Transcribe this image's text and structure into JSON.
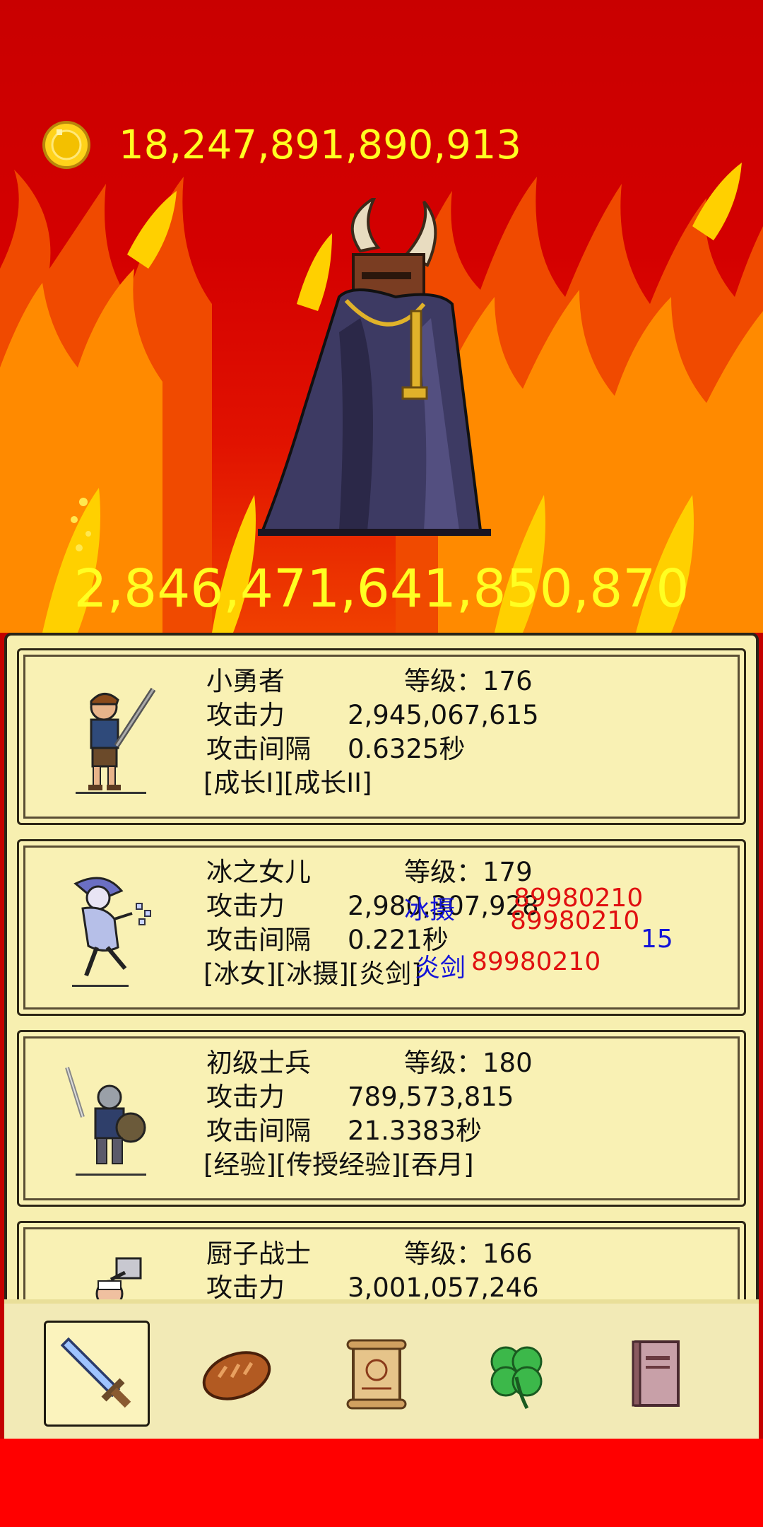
{
  "gold": {
    "icon": "gold-coin-icon",
    "amount": "18,247,891,890,913"
  },
  "boss": {
    "icon": "horned-demon-boss",
    "hp": "2,846,471,641,850,870"
  },
  "heroes": [
    {
      "name": "小勇者",
      "level_label": "等级：",
      "level": "176",
      "attack_label": "攻击力",
      "attack": "2,945,067,615",
      "interval_label": "攻击间隔",
      "interval": "0.6325秒",
      "skills": "[成长I][成长II]",
      "icon": "young-hero-sprite"
    },
    {
      "name": "冰之女儿",
      "level_label": "等级：",
      "level": "179",
      "attack_label": "攻击力",
      "attack": "2,980,307,928",
      "interval_label": "攻击间隔",
      "interval": "0.221秒",
      "skills": "[冰女][冰摄][炎剑]",
      "icon": "ice-daughter-sprite"
    },
    {
      "name": "初级士兵",
      "level_label": "等级：",
      "level": "180",
      "attack_label": "攻击力",
      "attack": "789,573,815",
      "interval_label": "攻击间隔",
      "interval": "21.3383秒",
      "skills": "[经验][传授经验][吞月]",
      "icon": "soldier-sprite"
    },
    {
      "name": "厨子战士",
      "level_label": "等级：",
      "level": "166",
      "attack_label": "攻击力",
      "attack": "3,001,057,246",
      "interval_label": "",
      "interval": "",
      "skills": "",
      "icon": "chef-warrior-sprite"
    }
  ],
  "damage_floats": [
    {
      "text": "冰摄",
      "color": "blue"
    },
    {
      "text": "89980210",
      "color": "red"
    },
    {
      "text": "89980210",
      "color": "red"
    },
    {
      "text": "15",
      "color": "blue"
    },
    {
      "text": "炎剑",
      "color": "blue"
    },
    {
      "text": "89980210",
      "color": "red"
    }
  ],
  "tabs": [
    {
      "icon": "sword-icon",
      "active": true
    },
    {
      "icon": "bread-icon",
      "active": false
    },
    {
      "icon": "scroll-icon",
      "active": false
    },
    {
      "icon": "clover-icon",
      "active": false
    },
    {
      "icon": "book-icon",
      "active": false
    }
  ],
  "colors": {
    "gold_text": "#ffff22",
    "panel_bg": "#f7efb0",
    "fire_red": "#d40000",
    "damage_red": "#e01010",
    "damage_blue": "#1414d8"
  }
}
